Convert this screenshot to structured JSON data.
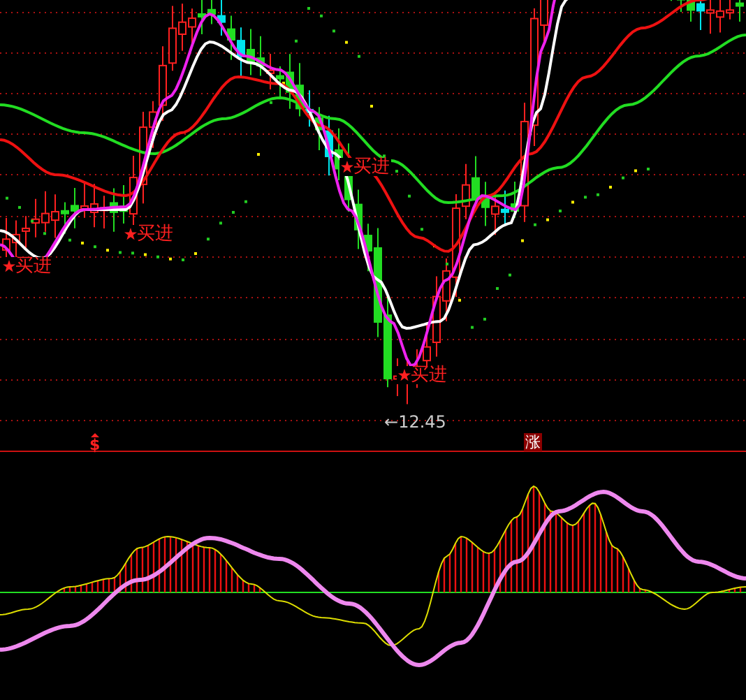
{
  "price_panel": {
    "buy_signals": [
      {
        "label": "买进"
      },
      {
        "label": "买进"
      },
      {
        "label": "买进"
      },
      {
        "label": "买进"
      }
    ],
    "low_marker": {
      "arrow": "←",
      "price": "12.45"
    }
  },
  "signal_strip": [
    {
      "kind": "dollar",
      "text": "$"
    },
    {
      "kind": "boxed",
      "text": "涨"
    }
  ]
}
